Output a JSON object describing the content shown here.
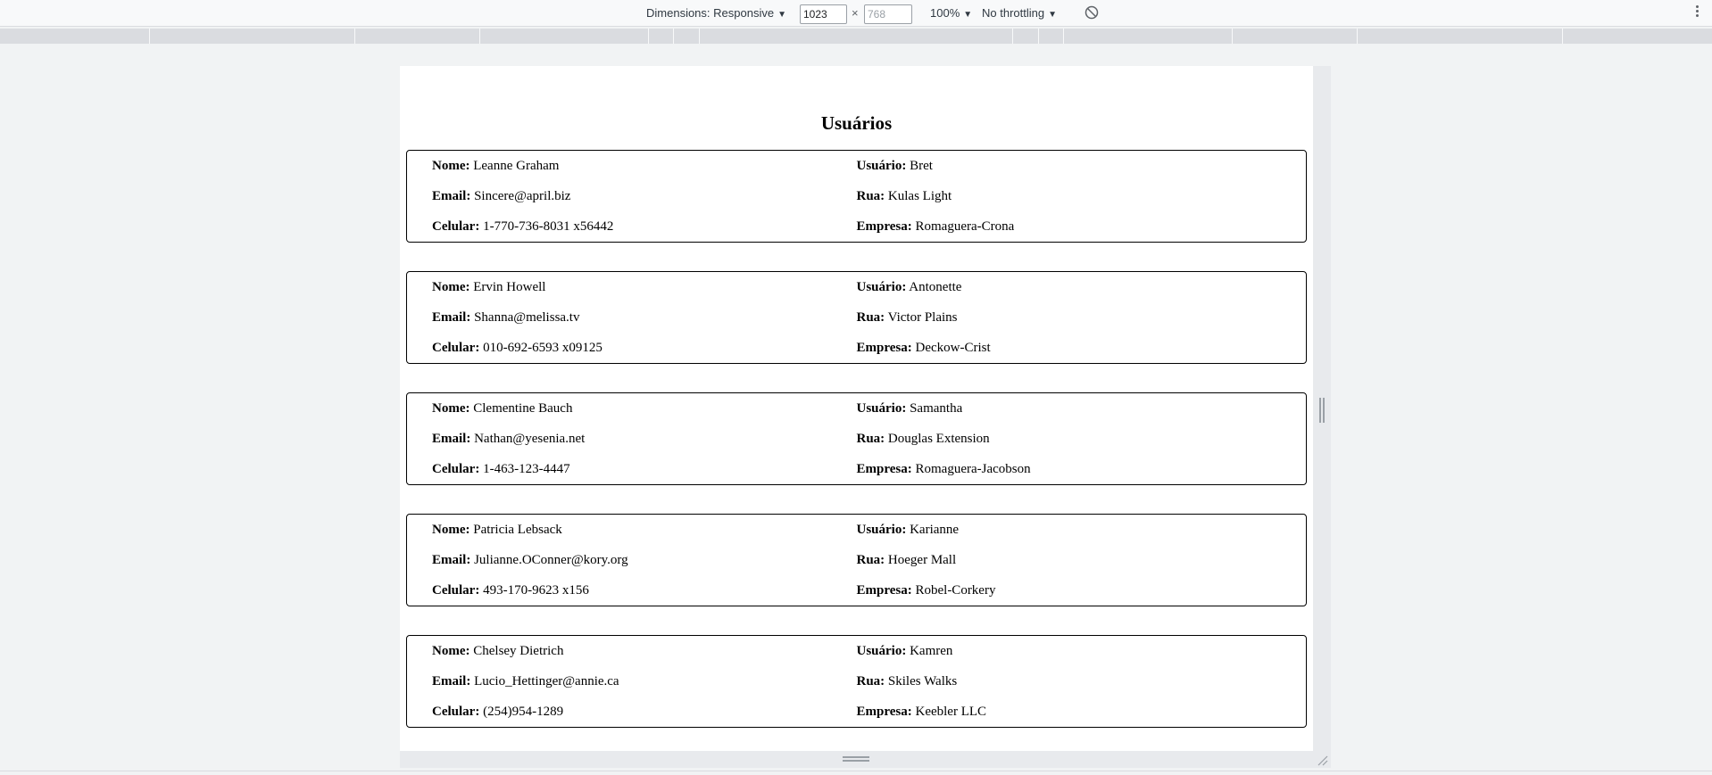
{
  "devtools": {
    "dimensions_label": "Dimensions: Responsive",
    "width_value": "1023",
    "height_placeholder": "768",
    "times_sign": "×",
    "zoom": "100%",
    "throttling": "No throttling",
    "caret": "▼"
  },
  "page": {
    "title": "Usuários",
    "labels": {
      "name": "Nome:",
      "email": "Email:",
      "phone": "Celular:",
      "username": "Usuário:",
      "street": "Rua:",
      "company": "Empresa:"
    },
    "users": [
      {
        "name": "Leanne Graham",
        "email": "Sincere@april.biz",
        "phone": "1-770-736-8031 x56442",
        "username": "Bret",
        "street": "Kulas Light",
        "company": "Romaguera-Crona"
      },
      {
        "name": "Ervin Howell",
        "email": "Shanna@melissa.tv",
        "phone": "010-692-6593 x09125",
        "username": "Antonette",
        "street": "Victor Plains",
        "company": "Deckow-Crist"
      },
      {
        "name": "Clementine Bauch",
        "email": "Nathan@yesenia.net",
        "phone": "1-463-123-4447",
        "username": "Samantha",
        "street": "Douglas Extension",
        "company": "Romaguera-Jacobson"
      },
      {
        "name": "Patricia Lebsack",
        "email": "Julianne.OConner@kory.org",
        "phone": "493-170-9623 x156",
        "username": "Karianne",
        "street": "Hoeger Mall",
        "company": "Robel-Corkery"
      },
      {
        "name": "Chelsey Dietrich",
        "email": "Lucio_Hettinger@annie.ca",
        "phone": "(254)954-1289",
        "username": "Kamren",
        "street": "Skiles Walks",
        "company": "Keebler LLC"
      }
    ]
  }
}
